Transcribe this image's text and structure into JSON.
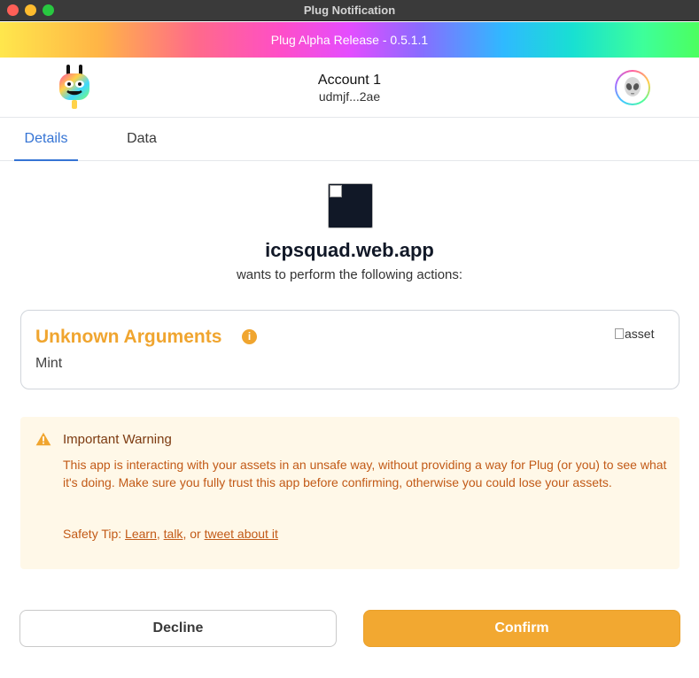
{
  "window": {
    "title": "Plug Notification"
  },
  "banner": {
    "text": "Plug Alpha Release - 0.5.1.1"
  },
  "account": {
    "name": "Account 1",
    "id": "udmjf...2ae",
    "logo_icon": "plug-logo-icon",
    "avatar_icon": "alien-avatar-icon"
  },
  "tabs": [
    {
      "label": "Details",
      "active": true
    },
    {
      "label": "Data",
      "active": false
    }
  ],
  "app": {
    "name": "icpsquad.web.app",
    "subtitle": "wants to perform the following actions:"
  },
  "action_card": {
    "title": "Unknown Arguments",
    "method": "Mint",
    "asset_alt": "asset",
    "info_icon": "info-icon"
  },
  "warning": {
    "title": "Important Warning",
    "body": "This app is interacting with your assets in an unsafe way, without providing a way for Plug (or you) to see what it's doing. Make sure you fully trust this app before confirming, otherwise you could lose your assets.",
    "tip_prefix": "Safety Tip: ",
    "link_learn": "Learn",
    "sep1": ", ",
    "link_talk": "talk",
    "sep2": ", or ",
    "link_tweet": "tweet about it"
  },
  "buttons": {
    "decline": "Decline",
    "confirm": "Confirm"
  },
  "colors": {
    "accent_orange": "#f2a831",
    "tab_active": "#3574d4",
    "warning_bg": "#fff8e8",
    "warning_text": "#c25a17"
  }
}
